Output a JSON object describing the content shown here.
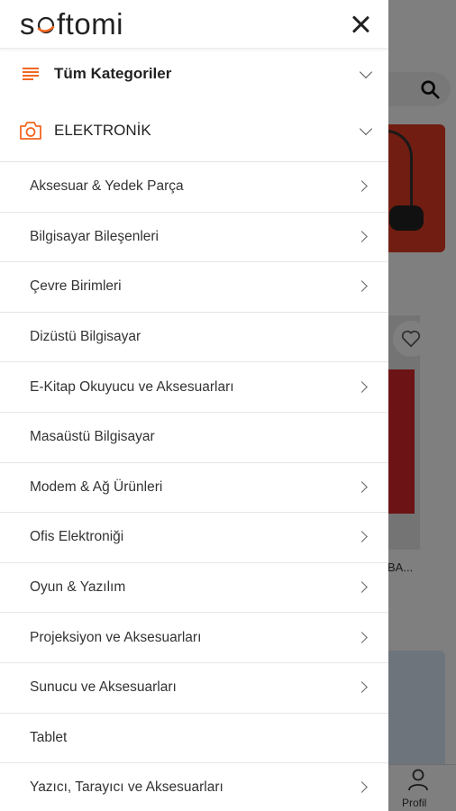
{
  "brand": {
    "logo_text_pre": "s",
    "logo_text_post": "ftomi",
    "accent": "#f26722"
  },
  "drawer": {
    "close_icon": "close-icon",
    "all_categories": {
      "label": "Tüm Kategoriler",
      "icon": "list-icon"
    },
    "current_category": {
      "label": "ELEKTRONİK",
      "icon": "camera-icon"
    },
    "subcategories": [
      {
        "label": "Aksesuar & Yedek Parça",
        "has_children": true
      },
      {
        "label": "Bilgisayar Bileşenleri",
        "has_children": true
      },
      {
        "label": "Çevre Birimleri",
        "has_children": true
      },
      {
        "label": "Dizüstü Bilgisayar",
        "has_children": false
      },
      {
        "label": "E-Kitap Okuyucu ve Aksesuarları",
        "has_children": true
      },
      {
        "label": "Masaüstü Bilgisayar",
        "has_children": false
      },
      {
        "label": "Modem & Ağ Ürünleri",
        "has_children": true
      },
      {
        "label": "Ofis Elektroniği",
        "has_children": true
      },
      {
        "label": "Oyun & Yazılım",
        "has_children": true
      },
      {
        "label": "Projeksiyon ve Aksesuarları",
        "has_children": true
      },
      {
        "label": "Sunucu ve Aksesuarları",
        "has_children": true
      },
      {
        "label": "Tablet",
        "has_children": false
      },
      {
        "label": "Yazıcı, Tarayıcı ve Aksesuarları",
        "has_children": true
      }
    ]
  },
  "background": {
    "product_text": "BA...",
    "bottom_nav": {
      "profile_label": "Profil"
    }
  }
}
